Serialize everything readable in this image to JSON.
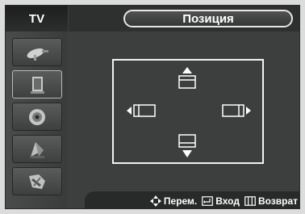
{
  "sidebar": {
    "tv_label": "TV",
    "items": [
      {
        "icon": "satellite-dish-icon"
      },
      {
        "icon": "speaker-icon"
      },
      {
        "icon": "cd-disc-icon"
      },
      {
        "icon": "plant-icon"
      },
      {
        "icon": "tools-icon"
      }
    ]
  },
  "menu": {
    "title": "Позиция"
  },
  "position_controls": {
    "up_icon": "arrow-up-screen-icon",
    "down_icon": "arrow-down-screen-icon",
    "left_icon": "arrow-left-screen-icon",
    "right_icon": "arrow-right-screen-icon"
  },
  "footer": {
    "move_label": "Перем.",
    "enter_label": "Вход",
    "return_label": "Возврат"
  },
  "colors": {
    "background": "#3d3e3e",
    "accent": "#ffffff",
    "frame": "#dcdcdc"
  }
}
